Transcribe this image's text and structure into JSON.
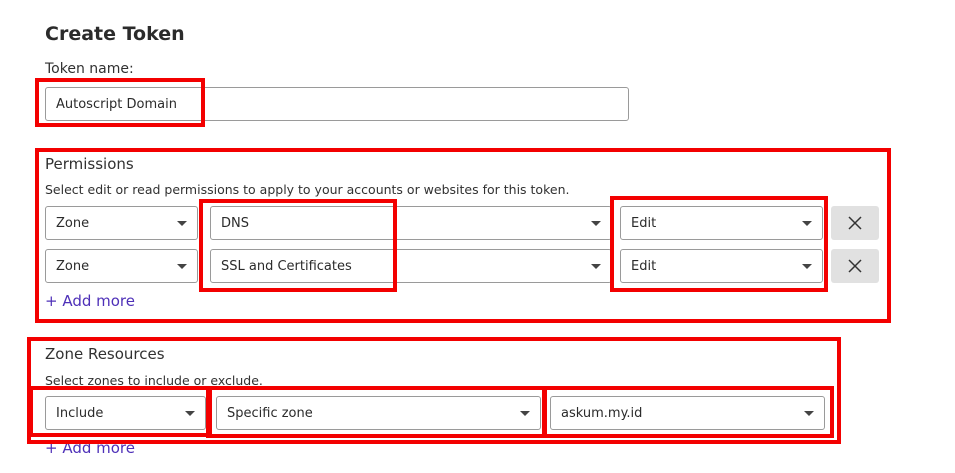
{
  "page": {
    "title": "Create Token"
  },
  "token_name": {
    "label": "Token name:",
    "value": "Autoscript Domain"
  },
  "permissions": {
    "title": "Permissions",
    "description": "Select edit or read permissions to apply to your accounts or websites for this token.",
    "rows": [
      {
        "scope": "Zone",
        "resource": "DNS",
        "access": "Edit"
      },
      {
        "scope": "Zone",
        "resource": "SSL and Certificates",
        "access": "Edit"
      }
    ],
    "add_more": "+ Add more"
  },
  "zone_resources": {
    "title": "Zone Resources",
    "description": "Select zones to include or exclude.",
    "row": {
      "mode": "Include",
      "type": "Specific zone",
      "zone": "askum.my.id"
    },
    "add_more": "+ Add more"
  },
  "colors": {
    "highlight": "#f30000",
    "link": "#4e30b8",
    "field_border": "#9a9a9a",
    "delete_bg": "#e1e1e1"
  },
  "icons": {
    "delete": "close-icon",
    "dropdown": "chevron-down-icon"
  }
}
